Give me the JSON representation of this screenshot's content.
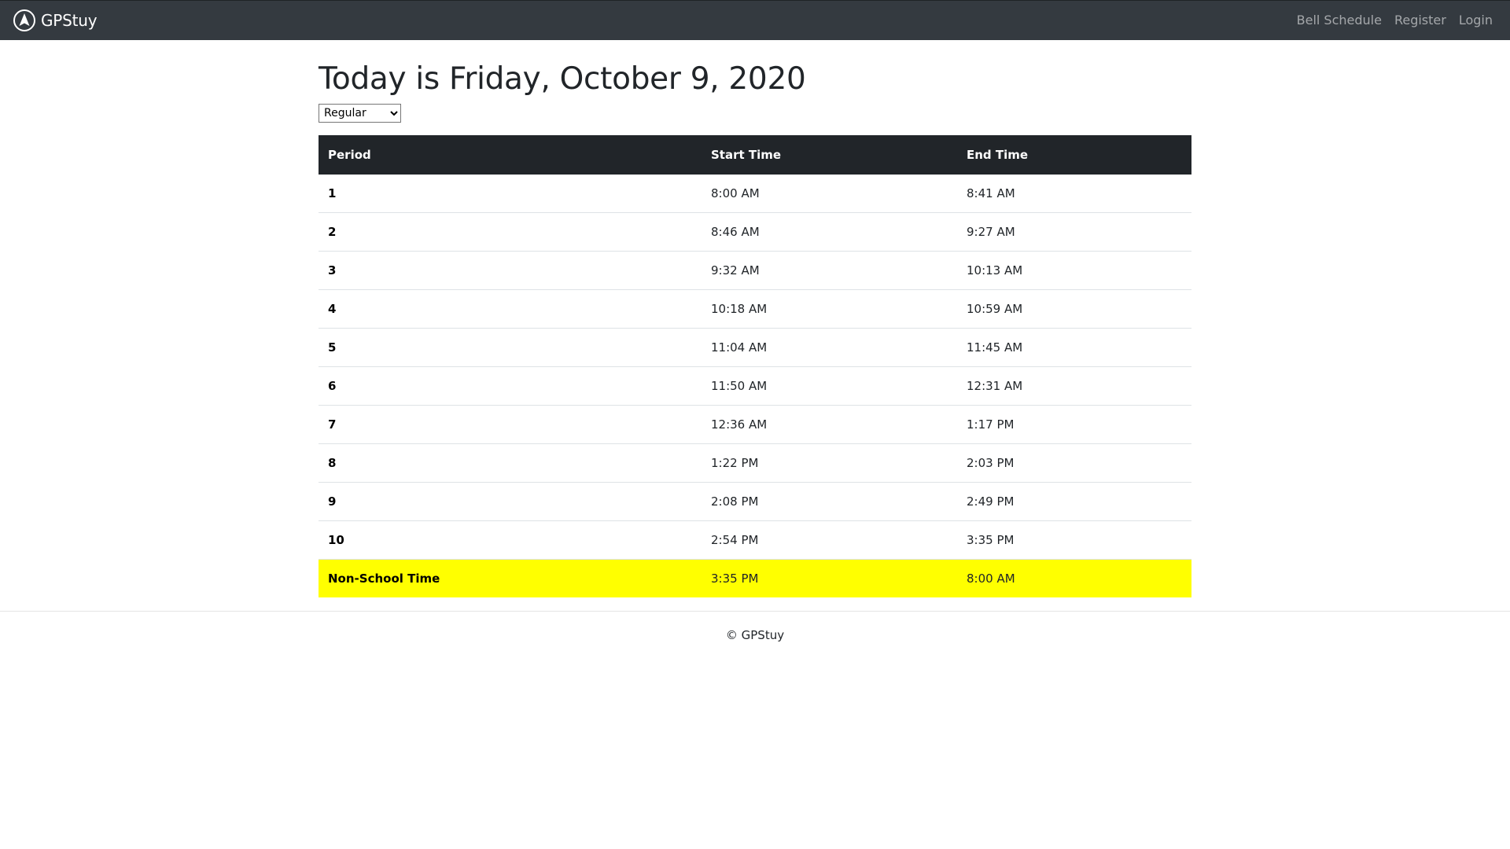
{
  "navbar": {
    "brand_name": "GPStuy",
    "brand_icon": "compass-arrow-icon",
    "links": [
      "Bell Schedule",
      "Register",
      "Login"
    ],
    "background": "#343a40"
  },
  "main": {
    "title": "Today is Friday, October 9, 2020",
    "schedule_select": {
      "selected": "Regular"
    },
    "table": {
      "headers": [
        "Period",
        "Start Time",
        "End Time"
      ],
      "rows": [
        {
          "period": "1",
          "start": "8:00 AM",
          "end": "8:41 AM"
        },
        {
          "period": "2",
          "start": "8:46 AM",
          "end": "9:27 AM"
        },
        {
          "period": "3",
          "start": "9:32 AM",
          "end": "10:13 AM"
        },
        {
          "period": "4",
          "start": "10:18 AM",
          "end": "10:59 AM"
        },
        {
          "period": "5",
          "start": "11:04 AM",
          "end": "11:45 AM"
        },
        {
          "period": "6",
          "start": "11:50 AM",
          "end": "12:31 AM"
        },
        {
          "period": "7",
          "start": "12:36 AM",
          "end": "1:17 PM"
        },
        {
          "period": "8",
          "start": "1:22 PM",
          "end": "2:03 PM"
        },
        {
          "period": "9",
          "start": "2:08 PM",
          "end": "2:49 PM"
        },
        {
          "period": "10",
          "start": "2:54 PM",
          "end": "3:35 PM"
        },
        {
          "period": "Non-School Time",
          "start": "3:35 PM",
          "end": "8:00 AM"
        }
      ],
      "highlight_color": "#ffff00",
      "header_background": "#212529"
    }
  },
  "footer": {
    "text": "© GPStuy"
  }
}
